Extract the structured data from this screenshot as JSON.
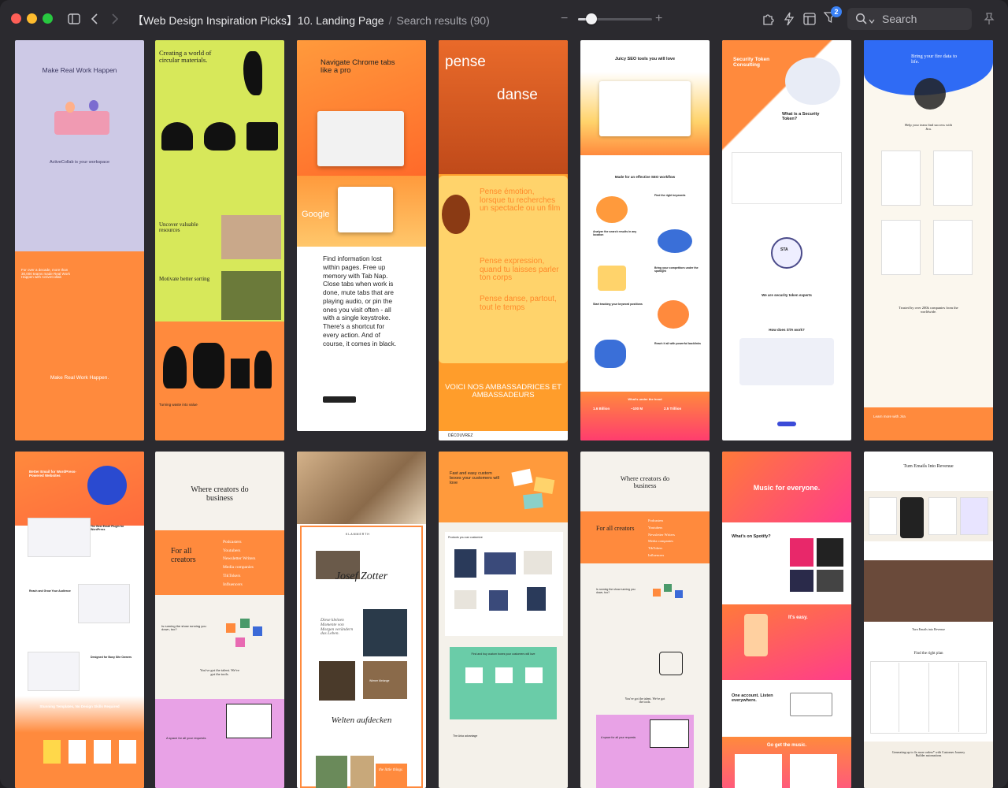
{
  "titlebar": {
    "title": "【Web Design Inspiration Picks】10. Landing Page",
    "separator": "/",
    "results": "Search results (90)",
    "filter_count": "2",
    "search_placeholder": "Search",
    "zoom_level": 0.18
  },
  "icons": {
    "sidebar": "sidebar-toggle-icon",
    "back": "chevron-left-icon",
    "forward": "chevron-right-icon",
    "extensions": "puzzle-icon",
    "actions": "lightning-icon",
    "layout": "layout-icon",
    "filter": "filter-icon",
    "search": "search-icon",
    "pin": "pin-icon"
  },
  "thumbnails": {
    "t1": {
      "headline": "Make Real Work Happen",
      "sub": "ActiveCollab is your workspace",
      "side": "For over a decade, more than 30,000 teams made Real Work Happen with ActiveCollab",
      "footer": "Make Real Work Happen."
    },
    "t2": {
      "headline": "Creating a world of circular materials.",
      "h2": "Uncover valuable resources",
      "h3": "Motivate better sorting",
      "h4": "Turning waste into value"
    },
    "t3": {
      "headline": "Navigate Chrome tabs like a pro",
      "google": "Google",
      "body": "Find information lost within pages. Free up memory with Tab Nap. Close tabs when work is done, mute tabs that are playing audio, or pin the ones you visit often - all with a single keystroke. There's a shortcut for every action. And of course, it comes in black."
    },
    "t4": {
      "w1": "pense",
      "w2": "danse",
      "p1": "Pense émotion, lorsque tu recherches un spectacle ou un film",
      "p2": "Pense expression, quand tu laisses parler ton corps",
      "p3": "Pense danse, partout, tout le temps",
      "footer": "VOICI NOS AMBASSADRICES ET AMBASSADEURS",
      "discover": "DÉCOUVREZ"
    },
    "t5": {
      "headline": "Juicy SEO tools you will love",
      "h2": "Made for an effective SEO workflow",
      "s1": "Find the right keywords",
      "s2": "Analyze the search results in any location",
      "s3": "Bring your competitors under the spotlight",
      "s4": "Start tracking your keyword positions",
      "s5": "Reach it all with powerful backlinks",
      "h3": "What's under the hood",
      "n1": "1.6 Billion",
      "n2": "~100 M",
      "n3": "2.5 Trillion"
    },
    "t6": {
      "headline": "Security Token Consulting",
      "h2": "What is a Security Token?",
      "h3": "We are security token experts",
      "h4": "How does STA work?",
      "badge": "STA"
    },
    "t7": {
      "headline": "Bring your fire data to life.",
      "sub": "Help your team find success with Jira.",
      "h2": "Trusted by over 200k companies from the worldwide.",
      "footer": "Learn more with Jira"
    },
    "t8": {
      "headline": "Better Email for WordPress-Powered Websites",
      "h2": "The Best Email Plugin for WordPress",
      "h3": "Reach and Grow Your Audience",
      "h4": "Designed for Busy Site Owners",
      "footer": "Stunning Templates, No Design Skills Required"
    },
    "t9": {
      "headline": "Where creators do business",
      "h2": "For all creators",
      "list": [
        "Podcasters",
        "Youtubers",
        "Newsletter Writers",
        "Media companies",
        "TikTokers",
        "Influencers"
      ],
      "h3": "Is running the show running you down, too?",
      "h4": "You've got the talent. We've got the tools.",
      "h5": "A space for all your requests"
    },
    "t10": {
      "brand": "KLAMMERTH",
      "name": "Josef Zotter",
      "quote": "Diese kleinen Momente von Morgen verändern das Leben.",
      "h2": "Welten aufdecken",
      "tag": "the little things",
      "tag2": "Wiener Melange"
    },
    "t11": {
      "headline": "Fast and easy custom boxes your customers will love",
      "h2": "Products you can customize",
      "h3": "Find and buy custom boxes your customers will love",
      "h4": "The Arka advantage"
    },
    "t12": {
      "headline": "Where creators do business",
      "h2": "For all creators",
      "list": [
        "Podcasters",
        "Youtubers",
        "Newsletter Writers",
        "Media companies",
        "TikTokers",
        "Influencers"
      ],
      "h3": "Is running the show running you down, too?",
      "h4": "You've got the talent. We've got the tools.",
      "h5": "A space for all your requests"
    },
    "t13": {
      "headline": "Music for everyone.",
      "h2": "What's on Spotify?",
      "h3": "It's easy.",
      "h4": "One account. Listen everywhere.",
      "h5": "Go get the music."
    },
    "t14": {
      "headline": "Turn Emails Into Revenue",
      "h2": "Turn Emails into Revenue",
      "h3": "Find the right plan",
      "footer": "Generating up to 4x more orders* with Customer Journey Builder automations"
    }
  },
  "colors": {
    "window_bg": "#2b2a2f",
    "accent_blue": "#3b82f6",
    "orange": "#ff8a3d",
    "lime": "#d7e85a",
    "lavender": "#c9c6e6"
  }
}
